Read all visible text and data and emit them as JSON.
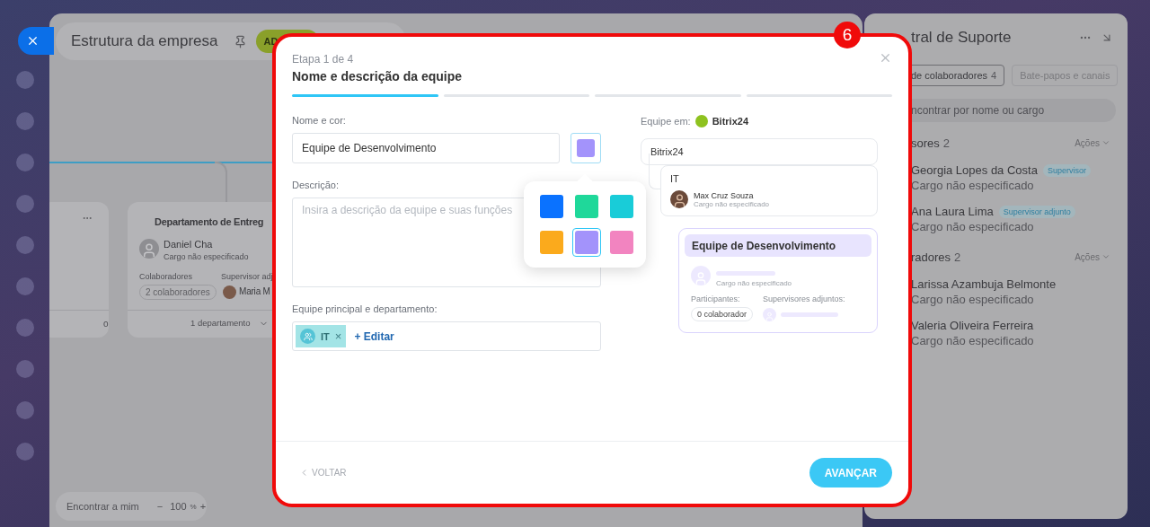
{
  "background": {
    "title": "Estrutura da empresa",
    "add_button": "AD",
    "cards": [
      {
        "kind": "partial",
        "footer": "o"
      },
      {
        "kind": "department",
        "title": "Departamento de Entreg",
        "head": "Daniel Cha",
        "head_role": "Cargo não especificado",
        "staff_label": "Colaboradores",
        "staff_count": "2 colaboradores",
        "deputy_label": "Supervisor adj",
        "deputy": "Maria M",
        "footer": "1 departamento"
      }
    ],
    "toolbar": {
      "find_me": "Encontrar a mim",
      "zoom_out": "−",
      "zoom": "100",
      "percent": "%",
      "zoom_in": "+"
    },
    "side_panel": {
      "title": "tral de Suporte",
      "tabs": [
        {
          "label": "de colaboradores",
          "count": "4",
          "selected": true
        },
        {
          "label": "Bate-papos e canais",
          "selected": false
        }
      ],
      "search": {
        "placeholder": "ncontrar por nome ou cargo"
      },
      "sections": [
        {
          "title": "sores",
          "count": "2",
          "action": "Ações",
          "members": [
            {
              "name": "Georgia Lopes da Costa",
              "badge": "Supervisor",
              "role": "Cargo não especificado"
            },
            {
              "name": "Ana Laura Lima",
              "badge": "Supervisor adjunto",
              "role": "Cargo não especificado"
            }
          ]
        },
        {
          "title": "radores",
          "count": "2",
          "action": "Ações",
          "members": [
            {
              "name": "Larissa Azambuja Belmonte",
              "role": "Cargo não especificado"
            },
            {
              "name": "Valeria Oliveira Ferreira",
              "role": "Cargo não especificado"
            }
          ]
        }
      ]
    }
  },
  "dialog": {
    "callout": "6",
    "step": "Etapa 1 de 4",
    "title": "Nome e descrição da equipe",
    "progress": [
      {
        "active": true
      },
      {
        "active": false
      },
      {
        "active": false
      },
      {
        "active": false
      }
    ],
    "name_label": "Nome e cor:",
    "name_value": "Equipe de Desenvolvimento",
    "palette": [
      {
        "color": "#0a72ff",
        "selected": false
      },
      {
        "color": "#1fd89a",
        "selected": false
      },
      {
        "color": "#19ccd8",
        "selected": false
      },
      {
        "color": "#fbaa1c",
        "selected": false
      },
      {
        "color": "#a393fb",
        "selected": true
      },
      {
        "color": "#f284c0",
        "selected": false
      }
    ],
    "description_label": "Descrição:",
    "description_placeholder": "Insira a descrição da equipe e suas funções",
    "parent_label": "Equipe principal e departamento:",
    "parent_tag": "IT",
    "tag_remove": "×",
    "edit_link": "+ Editar",
    "preview": {
      "label": "Equipe em:",
      "company": "Bitrix24",
      "root": "Bitrix24",
      "department": "IT",
      "head": "Max Cruz Souza",
      "head_role": "Cargo não especificado",
      "team": "Equipe de Desenvolvimento",
      "team_role": "Cargo não especificado",
      "participants_label": "Participantes:",
      "participants": "0 colaborador",
      "deputies_label": "Supervisores adjuntos:"
    },
    "back": "VOLTAR",
    "next": "AVANÇAR"
  }
}
